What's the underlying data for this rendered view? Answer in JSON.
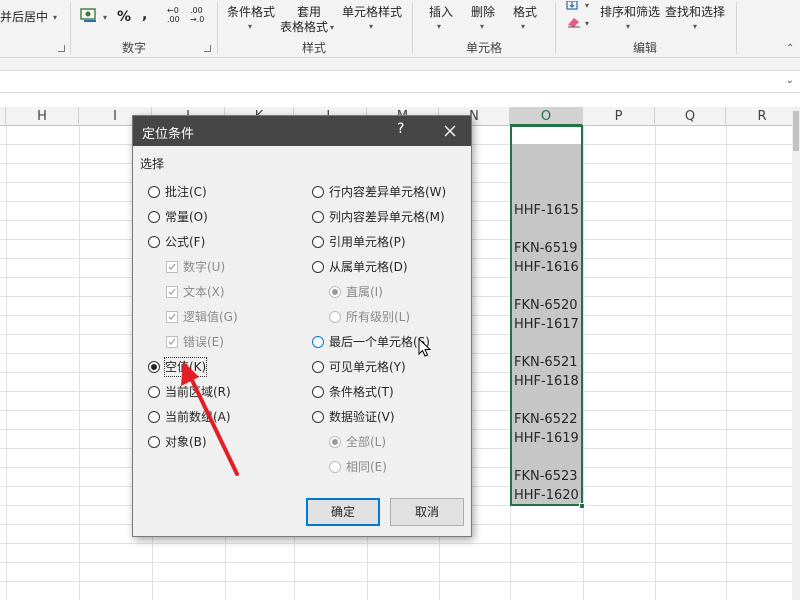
{
  "ribbon": {
    "merge_center": "合并后居中",
    "number_group": "数字",
    "percent": "%",
    "comma": ",",
    "dec_increase": "←0",
    "dec_increase_sub": ".00",
    "dec_decrease": ".00",
    "dec_decrease_sub": "→.0",
    "cond_format": "条件格式",
    "table_format_1": "套用",
    "table_format_2": "表格格式",
    "cell_style": "单元格样式",
    "styles_group": "样式",
    "insert": "插入",
    "delete": "删除",
    "format": "格式",
    "cells_group": "单元格",
    "sort_filter": "排序和筛选",
    "find_select": "查找和选择",
    "editing_group": "编辑"
  },
  "columns": [
    "H",
    "I",
    "J",
    "K",
    "L",
    "M",
    "N",
    "O",
    "P",
    "Q",
    "R"
  ],
  "column_o_cells": [
    "",
    "",
    "",
    "",
    "HHF-1615",
    "",
    "FKN-6519",
    "HHF-1616",
    "",
    "FKN-6520",
    "HHF-1617",
    "",
    "FKN-6521",
    "HHF-1618",
    "",
    "FKN-6522",
    "HHF-1619",
    "",
    "FKN-6523",
    "HHF-1620"
  ],
  "dialog": {
    "title": "定位条件",
    "help": "?",
    "group_label": "选择",
    "left_options": [
      {
        "label": "批注(C)",
        "state": "off"
      },
      {
        "label": "常量(O)",
        "state": "off"
      },
      {
        "label": "公式(F)",
        "state": "off"
      },
      {
        "label": "数字(U)",
        "state": "disabled-check"
      },
      {
        "label": "文本(X)",
        "state": "disabled-check"
      },
      {
        "label": "逻辑值(G)",
        "state": "disabled-check"
      },
      {
        "label": "错误(E)",
        "state": "disabled-check"
      },
      {
        "label": "空值(K)",
        "state": "on"
      },
      {
        "label": "当前区域(R)",
        "state": "off"
      },
      {
        "label": "当前数组(A)",
        "state": "off"
      },
      {
        "label": "对象(B)",
        "state": "off"
      }
    ],
    "right_options": [
      {
        "label": "行内容差异单元格(W)",
        "state": "off"
      },
      {
        "label": "列内容差异单元格(M)",
        "state": "off"
      },
      {
        "label": "引用单元格(P)",
        "state": "off"
      },
      {
        "label": "从属单元格(D)",
        "state": "off"
      },
      {
        "label": "直属(I)",
        "state": "disabled-on"
      },
      {
        "label": "所有级别(L)",
        "state": "disabled-off"
      },
      {
        "label": "最后一个单元格(S)",
        "state": "hover"
      },
      {
        "label": "可见单元格(Y)",
        "state": "off"
      },
      {
        "label": "条件格式(T)",
        "state": "off"
      },
      {
        "label": "数据验证(V)",
        "state": "off"
      },
      {
        "label": "全部(L)",
        "state": "disabled-on"
      },
      {
        "label": "相同(E)",
        "state": "disabled-off"
      }
    ],
    "ok_label": "确定",
    "cancel_label": "取消"
  },
  "colors": {
    "accent_green": "#217346",
    "selection_gray": "#c6c6c6",
    "dialog_title_bg": "#464646",
    "focus_blue": "#0078d7",
    "annotation_red": "#e31e24"
  }
}
